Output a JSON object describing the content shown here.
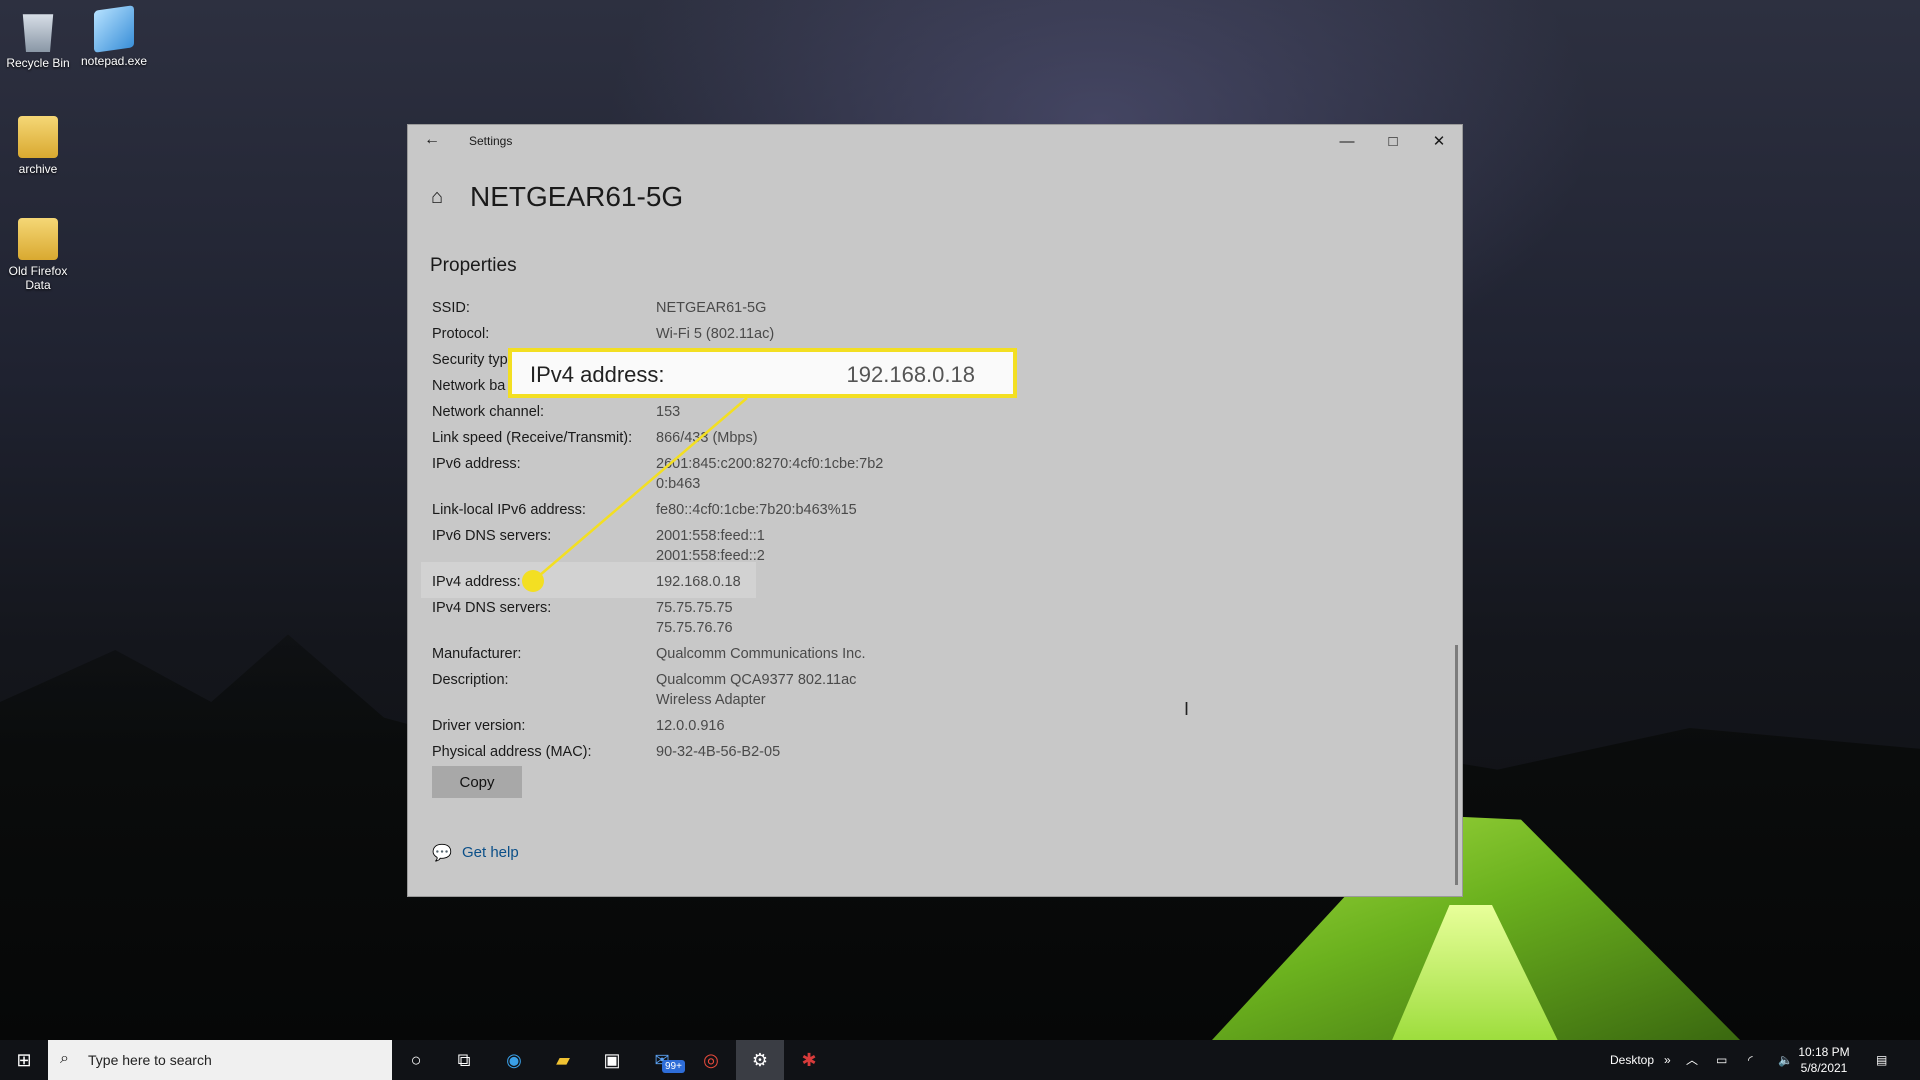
{
  "desktop": {
    "icons": [
      {
        "label": "Recycle Bin"
      },
      {
        "label": "notepad.exe"
      },
      {
        "label": "archive"
      },
      {
        "label": "Old Firefox Data"
      }
    ]
  },
  "window": {
    "title": "Settings",
    "back_glyph": "←",
    "minimize_glyph": "—",
    "maximize_glyph": "□",
    "close_glyph": "✕",
    "network_name": "NETGEAR61-5G",
    "section_title": "Properties",
    "properties": [
      {
        "label": "SSID:",
        "value": "NETGEAR61-5G"
      },
      {
        "label": "Protocol:",
        "value": "Wi-Fi 5 (802.11ac)"
      },
      {
        "label": "Security typ",
        "value": ""
      },
      {
        "label": "Network ba",
        "value": ""
      },
      {
        "label": "Network channel:",
        "value": "153"
      },
      {
        "label": "Link speed (Receive/Transmit):",
        "value": "866/433 (Mbps)"
      },
      {
        "label": "IPv6 address:",
        "value": "2601:845:c200:8270:4cf0:1cbe:7b2",
        "value2": "0:b463"
      },
      {
        "label": "Link-local IPv6 address:",
        "value": "fe80::4cf0:1cbe:7b20:b463%15"
      },
      {
        "label": "IPv6 DNS servers:",
        "value": "2001:558:feed::1",
        "value2": "2001:558:feed::2"
      },
      {
        "label": "IPv4 address:",
        "value": "192.168.0.18"
      },
      {
        "label": "IPv4 DNS servers:",
        "value": "75.75.75.75",
        "value2": "75.75.76.76"
      },
      {
        "label": "Manufacturer:",
        "value": "Qualcomm Communications Inc."
      },
      {
        "label": "Description:",
        "value": "Qualcomm QCA9377 802.11ac",
        "value2": "Wireless Adapter"
      },
      {
        "label": "Driver version:",
        "value": "12.0.0.916"
      },
      {
        "label": "Physical address (MAC):",
        "value": "90-32-4B-56-B2-05"
      }
    ],
    "copy_label": "Copy",
    "help_label": "Get help"
  },
  "callout": {
    "label": "IPv4 address:",
    "value": "192.168.0.18",
    "color": "#f3df22"
  },
  "taskbar": {
    "search_placeholder": "Type here to search",
    "mail_badge": "99+",
    "desktop_label": "Desktop",
    "time": "10:18 PM",
    "date": "5/8/2021"
  }
}
